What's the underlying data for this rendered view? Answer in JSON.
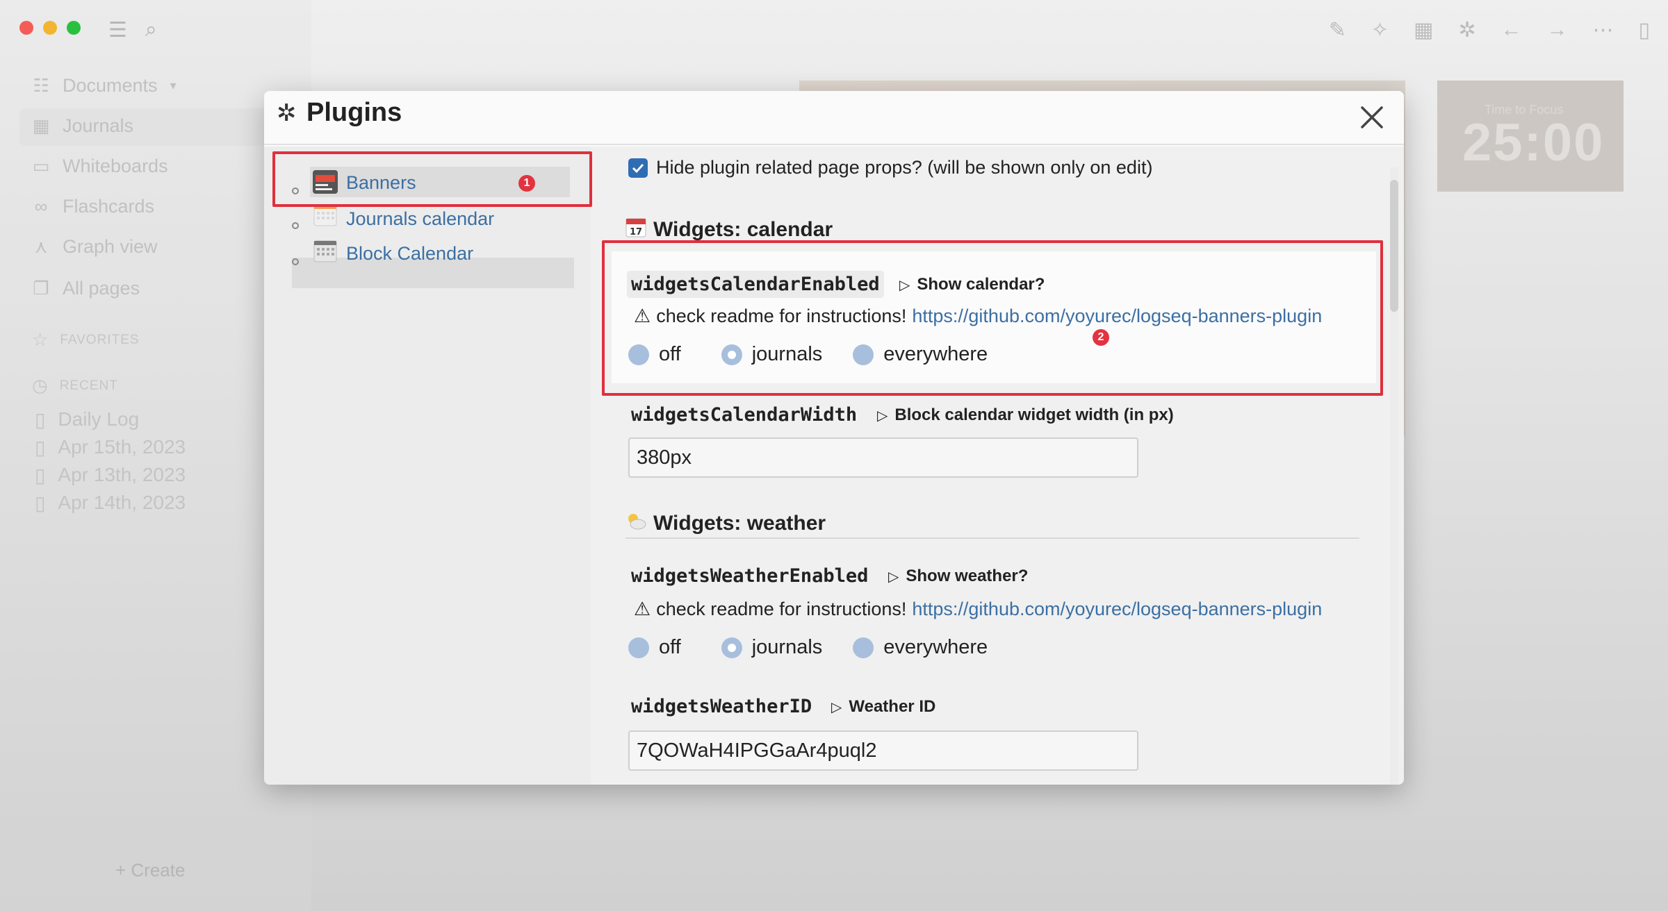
{
  "app": {
    "nav": [
      "Documents",
      "Journals",
      "Whiteboards",
      "Flashcards",
      "Graph view",
      "All pages"
    ],
    "favorites_label": "FAVORITES",
    "recent_label": "RECENT",
    "recent": [
      "Daily Log",
      "Apr 15th, 2023",
      "Apr 13th, 2023",
      "Apr 14th, 2023"
    ],
    "create_label": "+ Create",
    "timer_caption": "Time to Focus",
    "timer_value": "25:00"
  },
  "modal": {
    "title": "Plugins",
    "plugins": [
      {
        "label": "Banners",
        "badge": "1",
        "active": true
      },
      {
        "label": "Journals calendar",
        "active": false
      },
      {
        "label": "Block Calendar",
        "active": false
      }
    ]
  },
  "settings": {
    "hide_props_label": "Hide plugin related page props? (will be shown only on edit)",
    "calendar_section": "Widgets: calendar",
    "calendar_enabled": {
      "key": "widgetsCalendarEnabled",
      "desc": "Show calendar?",
      "warn": "check readme for instructions!",
      "link": "https://github.com/yoyurec/logseq-banners-plugin",
      "options": [
        "off",
        "journals",
        "everywhere"
      ],
      "selected": "journals",
      "badge": "2"
    },
    "calendar_width": {
      "key": "widgetsCalendarWidth",
      "desc": "Block calendar widget width (in px)",
      "value": "380px"
    },
    "weather_section": "Widgets: weather",
    "weather_enabled": {
      "key": "widgetsWeatherEnabled",
      "desc": "Show weather?",
      "warn": "check readme for instructions!",
      "link": "https://github.com/yoyurec/logseq-banners-plugin",
      "options": [
        "off",
        "journals",
        "everywhere"
      ],
      "selected": "journals"
    },
    "weather_id": {
      "key": "widgetsWeatherID",
      "desc": "Weather ID",
      "value": "7QOWaH4IPGGaAr4puql2"
    }
  },
  "colors": {
    "accent": "#2e6db4",
    "link": "#3b6fa3",
    "annotation_red": "#e0303d"
  }
}
